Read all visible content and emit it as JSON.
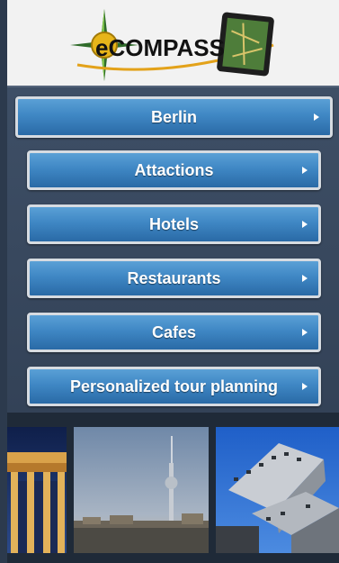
{
  "header": {
    "logo_text": "eCOMPASS",
    "logo_icon": "compass-icon",
    "device_icon": "tablet-map-icon"
  },
  "menu": {
    "city": "Berlin",
    "items": [
      {
        "label": "Attactions"
      },
      {
        "label": "Hotels"
      },
      {
        "label": "Restaurants"
      },
      {
        "label": "Cafes"
      },
      {
        "label": "Personalized tour planning"
      }
    ]
  },
  "photos": [
    {
      "name": "brandenburg-gate-photo"
    },
    {
      "name": "tv-tower-photo"
    },
    {
      "name": "modern-hotel-photo"
    }
  ],
  "colors": {
    "button_top": "#5aa0d6",
    "button_bottom": "#2a6aa6",
    "panel": "#3e4f66"
  }
}
